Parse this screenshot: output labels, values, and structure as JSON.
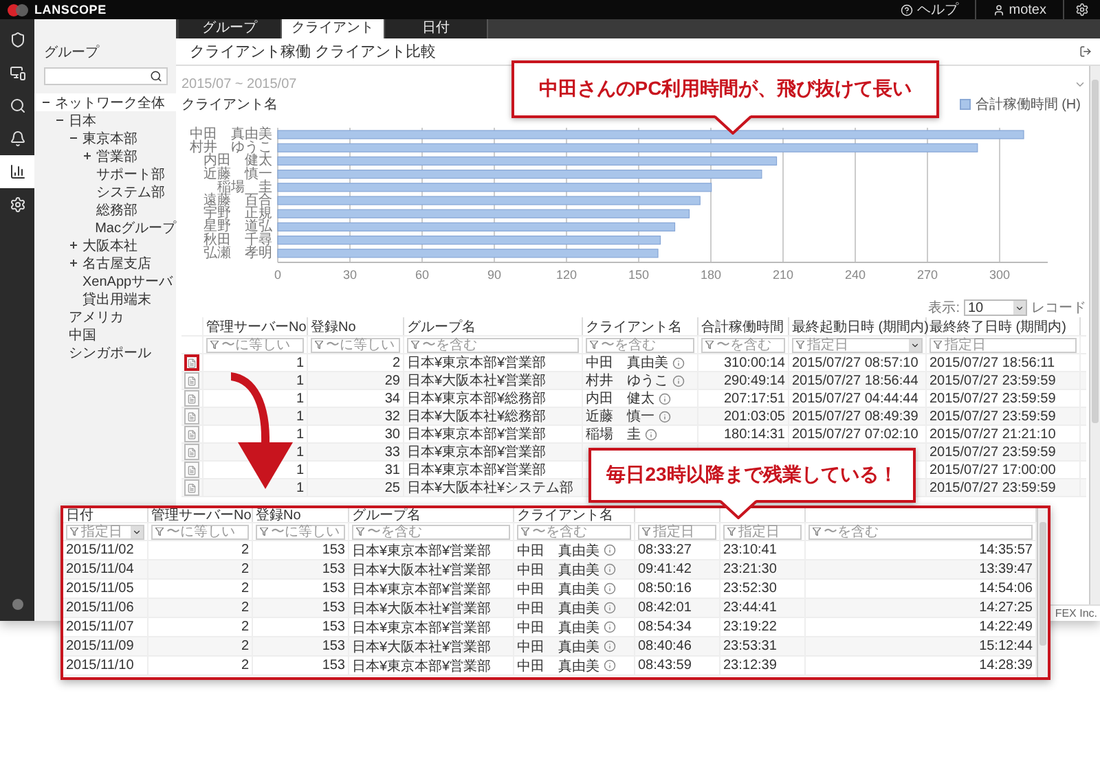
{
  "top_bar": {
    "logo": "LANSCOPE",
    "links": [
      {
        "kind": "help",
        "label": "ヘルプ"
      },
      {
        "kind": "user",
        "label": "motex"
      }
    ]
  },
  "rail": {
    "items": [
      {
        "kind": "shield",
        "selected": false
      },
      {
        "kind": "monitor",
        "selected": false
      },
      {
        "kind": "search",
        "selected": false
      },
      {
        "kind": "bell",
        "selected": false
      },
      {
        "kind": "chart",
        "selected": true
      },
      {
        "kind": "settings",
        "selected": false
      }
    ]
  },
  "sidebar": {
    "title": "グループ",
    "tree": [
      {
        "label": "ネットワーク全体",
        "expanded": true,
        "selected": true,
        "children": [
          {
            "label": "日本",
            "expanded": true,
            "selected": false,
            "children": [
              {
                "label": "東京本部",
                "expanded": true,
                "selected": false,
                "children": [
                  {
                    "label": "営業部",
                    "expanded": false,
                    "selected": false
                  },
                  {
                    "label": "サポート部",
                    "selected": false
                  },
                  {
                    "label": "システム部",
                    "selected": false
                  },
                  {
                    "label": "総務部",
                    "selected": false
                  },
                  {
                    "label": "Macグループ",
                    "selected": false
                  }
                ]
              },
              {
                "label": "大阪本社",
                "expanded": false,
                "selected": false
              },
              {
                "label": "名古屋支店",
                "expanded": false,
                "selected": false
              },
              {
                "label": "XenAppサーバ",
                "selected": false
              },
              {
                "label": "貸出用端末",
                "selected": false
              }
            ]
          },
          {
            "label": "アメリカ",
            "selected": false
          },
          {
            "label": "中国",
            "selected": false
          },
          {
            "label": "シンガポール",
            "selected": false
          }
        ]
      }
    ]
  },
  "tabs": [
    {
      "label": "グループ",
      "selected": false
    },
    {
      "label": "クライアント",
      "selected": true
    },
    {
      "label": "日付",
      "selected": false
    }
  ],
  "page": {
    "title": "クライアント稼働 クライアント比較",
    "period": "2015/07 ~ 2015/07",
    "chart_title": "クライアント名",
    "chart_data": {
      "type": "bar",
      "orientation": "horizontal",
      "grid": true,
      "categories": [
        "中田　真由美",
        "村井　ゆうこ",
        "内田　健太",
        "近藤　慎一",
        "稲場　圭",
        "遠藤　百合",
        "宇野　正規",
        "星野　道弘",
        "秋田　千尋",
        "弘瀬　孝明"
      ],
      "series": [
        {
          "name": "合計稼働時間 (H)",
          "color": "#a9c5ea",
          "values": [
            310.0,
            290.8,
            207.3,
            201.1,
            180.2,
            175.5,
            171,
            165,
            159,
            158
          ]
        }
      ],
      "xlim": [
        0,
        320
      ],
      "xticks": [
        0,
        30,
        60,
        90,
        120,
        150,
        180,
        210,
        240,
        270,
        300
      ]
    }
  },
  "table": {
    "show_label": "表示:",
    "page_size": "10",
    "unit": "レコード",
    "columns": [
      {
        "label": "管理サーバーNo",
        "kind": "number",
        "filter": {
          "placeholder": "〜に等しい",
          "dropdown": false
        }
      },
      {
        "label": "登録No",
        "kind": "number",
        "filter": {
          "placeholder": "〜に等しい",
          "dropdown": false
        }
      },
      {
        "label": "グループ名",
        "kind": "text",
        "filter": {
          "placeholder": "〜を含む",
          "dropdown": false
        }
      },
      {
        "label": "クライアント名",
        "kind": "client",
        "filter": {
          "placeholder": "〜を含む",
          "dropdown": false
        }
      },
      {
        "label": "合計稼働時間",
        "kind": "number",
        "filter": {
          "placeholder": "〜を含む",
          "dropdown": false
        }
      },
      {
        "label": "最終起動日時 (期間内)",
        "kind": "text",
        "filter": {
          "placeholder": "指定日",
          "dropdown": true
        }
      },
      {
        "label": "最終終了日時 (期間内)",
        "kind": "text",
        "filter": {
          "placeholder": "指定日",
          "dropdown": false
        }
      }
    ],
    "rows": [
      {
        "highlighted": true,
        "cells": [
          "1",
          "2",
          "日本¥東京本部¥営業部",
          "中田　真由美",
          "310:00:14",
          "2015/07/27 08:57:10",
          "2015/07/27 18:56:11"
        ]
      },
      {
        "highlighted": false,
        "cells": [
          "1",
          "29",
          "日本¥大阪本社¥営業部",
          "村井　ゆうこ",
          "290:49:14",
          "2015/07/27 18:56:44",
          "2015/07/27 23:59:59"
        ]
      },
      {
        "highlighted": false,
        "cells": [
          "1",
          "34",
          "日本¥東京本部¥総務部",
          "内田　健太",
          "207:17:51",
          "2015/07/27 04:44:44",
          "2015/07/27 23:59:59"
        ]
      },
      {
        "highlighted": false,
        "cells": [
          "1",
          "32",
          "日本¥大阪本社¥総務部",
          "近藤　慎一",
          "201:03:05",
          "2015/07/27 08:49:39",
          "2015/07/27 23:59:59"
        ]
      },
      {
        "highlighted": false,
        "cells": [
          "1",
          "30",
          "日本¥東京本部¥営業部",
          "稲場　圭",
          "180:14:31",
          "2015/07/27 07:02:10",
          "2015/07/27 21:21:10"
        ]
      },
      {
        "highlighted": false,
        "cells": [
          "1",
          "33",
          "日本¥東京本部¥営業部",
          null,
          null,
          null,
          "2015/07/27 23:59:59"
        ]
      },
      {
        "highlighted": false,
        "cells": [
          "1",
          "31",
          "日本¥東京本部¥営業部",
          null,
          null,
          null,
          "2015/07/27 17:00:00"
        ]
      },
      {
        "highlighted": false,
        "cells": [
          "1",
          "25",
          "日本¥大阪本社¥システム部",
          null,
          null,
          null,
          "2015/07/27 23:59:59"
        ]
      }
    ]
  },
  "footer": {
    "text": "FEX Inc."
  },
  "detail": {
    "columns": [
      {
        "label": "日付",
        "kind": "text",
        "filter": {
          "placeholder": "指定日",
          "dropdown": true
        }
      },
      {
        "label": "管理サーバーNo",
        "kind": "number",
        "filter": {
          "placeholder": "〜に等しい",
          "dropdown": false
        }
      },
      {
        "label": "登録No",
        "kind": "number",
        "filter": {
          "placeholder": "〜に等しい",
          "dropdown": false
        }
      },
      {
        "label": "グループ名",
        "kind": "text",
        "filter": {
          "placeholder": "〜を含む",
          "dropdown": false
        }
      },
      {
        "label": "クライアント名",
        "kind": "client",
        "filter": {
          "placeholder": "〜を含む",
          "dropdown": false
        }
      },
      {
        "kind": "text",
        "filter": {
          "placeholder": "指定日",
          "dropdown": false
        }
      },
      {
        "kind": "text",
        "filter": {
          "placeholder": "指定日",
          "dropdown": false
        }
      },
      {
        "kind": "number",
        "filter": {
          "placeholder": "〜を含む",
          "dropdown": false
        }
      }
    ],
    "rows": [
      [
        "2015/11/02",
        "2",
        "153",
        "日本¥東京本部¥営業部",
        "中田　真由美",
        "08:33:27",
        "23:10:41",
        "14:35:57"
      ],
      [
        "2015/11/04",
        "2",
        "153",
        "日本¥大阪本社¥営業部",
        "中田　真由美",
        "09:41:42",
        "23:21:30",
        "13:39:47"
      ],
      [
        "2015/11/05",
        "2",
        "153",
        "日本¥東京本部¥営業部",
        "中田　真由美",
        "08:50:16",
        "23:52:30",
        "14:54:06"
      ],
      [
        "2015/11/06",
        "2",
        "153",
        "日本¥大阪本社¥営業部",
        "中田　真由美",
        "08:42:01",
        "23:44:41",
        "14:27:25"
      ],
      [
        "2015/11/07",
        "2",
        "153",
        "日本¥東京本部¥営業部",
        "中田　真由美",
        "08:54:34",
        "23:19:22",
        "14:22:49"
      ],
      [
        "2015/11/09",
        "2",
        "153",
        "日本¥大阪本社¥営業部",
        "中田　真由美",
        "08:40:46",
        "23:53:31",
        "15:12:44"
      ],
      [
        "2015/11/10",
        "2",
        "153",
        "日本¥東京本部¥営業部",
        "中田　真由美",
        "08:43:59",
        "23:12:39",
        "14:28:39"
      ]
    ]
  },
  "callouts": [
    {
      "text": "中田さんのPC利用時間が、飛び抜けて長い"
    },
    {
      "text": "毎日23時以降まで残業している！"
    }
  ]
}
